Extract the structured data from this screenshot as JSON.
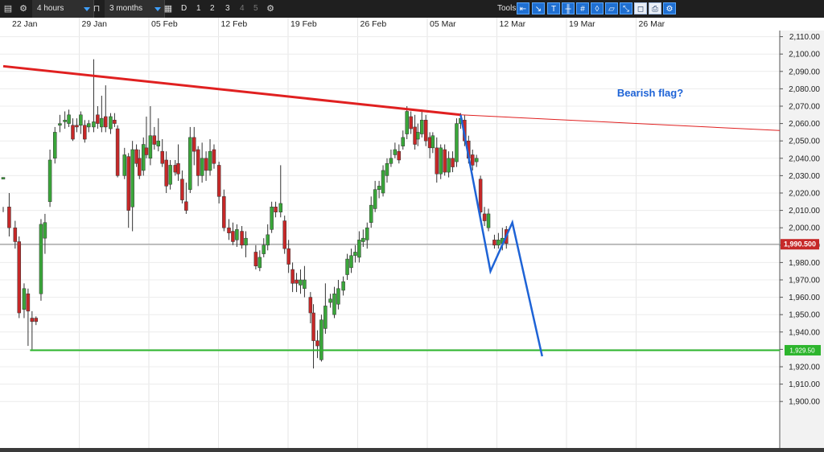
{
  "toolbar": {
    "timeframe": "4 hours",
    "range": "3 months",
    "periods": [
      "D",
      "1",
      "2",
      "3",
      "4",
      "5"
    ],
    "tools_label": "Tools",
    "tool_icons": [
      "arrow-left-icon",
      "cursor-icon",
      "text-tool-icon",
      "crosshair-icon",
      "grid-icon",
      "marker-icon",
      "layers-icon",
      "zoom-icon",
      "eraser-icon",
      "print-icon",
      "settings-icon"
    ]
  },
  "chart_data": {
    "type": "candlestick",
    "instrument_price": 1990.5,
    "x_tick_labels": [
      "22 Jan",
      "29 Jan",
      "05 Feb",
      "12 Feb",
      "19 Feb",
      "26 Feb",
      "05 Mar",
      "12 Mar",
      "19 Mar",
      "26 Mar"
    ],
    "y_range": [
      1890,
      2115
    ],
    "y_ticks": [
      2110,
      2100,
      2090,
      2080,
      2070,
      2060,
      2050,
      2040,
      2030,
      2020,
      2010,
      2000,
      1990,
      1980,
      1970,
      1960,
      1950,
      1940,
      1930,
      1920,
      1910,
      1900
    ],
    "y_tick_labels": [
      "2,110.00",
      "2,100.00",
      "2,090.00",
      "2,080.00",
      "2,070.00",
      "2,060.00",
      "2,050.00",
      "2,040.00",
      "2,030.00",
      "2,020.00",
      "2,010.00",
      "2,000.00",
      "1,990.00",
      "1,980.00",
      "1,970.00",
      "1,960.00",
      "1,950.00",
      "1,940.00",
      "1,930.00",
      "1,920.00",
      "1,910.00",
      "1,900.00"
    ],
    "current_price_label": "1,990.500",
    "support_label": "1,929.50",
    "support_level": 1929.5,
    "annotation": "Bearish flag?",
    "colors": {
      "up": "#3aa63a",
      "down": "#c62828",
      "resistance": "#e02020",
      "support": "#2db52d",
      "projection": "#1e63d6",
      "annotation": "#1e63d6"
    },
    "resistance_line": [
      [
        0,
        2093
      ],
      [
        46,
        2065
      ],
      [
        64,
        2056
      ]
    ],
    "projection_path": [
      [
        46,
        2065
      ],
      [
        49,
        1975
      ],
      [
        51.2,
        2003
      ],
      [
        54.2,
        1926
      ]
    ],
    "candles": [
      [
        0,
        2028,
        2029,
        2012,
        2009
      ],
      [
        0.6,
        2012,
        2000,
        1995,
        2020
      ],
      [
        1.2,
        2000,
        1992,
        1988,
        2004
      ],
      [
        1.6,
        1992,
        1951,
        1948,
        1995
      ],
      [
        2.1,
        1953,
        1965,
        1948,
        1968
      ],
      [
        2.5,
        1962,
        1952,
        1932,
        1965
      ],
      [
        2.9,
        1948,
        1946,
        1930,
        1952
      ],
      [
        3.3,
        1948,
        1946,
        1944,
        1949
      ],
      [
        3.8,
        1962,
        2002,
        1958,
        2005
      ],
      [
        4.2,
        1994,
        2003,
        1985,
        2008
      ],
      [
        4.7,
        2015,
        2039,
        2012,
        2045
      ],
      [
        5.2,
        2040,
        2055,
        2037,
        2058
      ],
      [
        5.7,
        2059,
        2060,
        2055,
        2065
      ],
      [
        6.2,
        2061,
        2062,
        2057,
        2067
      ],
      [
        6.6,
        2060,
        2065,
        2058,
        2068
      ],
      [
        7.0,
        2059,
        2051,
        2050,
        2063
      ],
      [
        7.4,
        2059,
        2058,
        2055,
        2063
      ],
      [
        7.8,
        2059,
        2065,
        2054,
        2067
      ],
      [
        8.2,
        2059,
        2051,
        2049,
        2062
      ],
      [
        8.6,
        2058,
        2060,
        2055,
        2062
      ],
      [
        9.1,
        2058,
        2061,
        2055,
        2097
      ],
      [
        9.5,
        2065,
        2060,
        2057,
        2070
      ],
      [
        9.9,
        2058,
        2063,
        2055,
        2076
      ],
      [
        10.3,
        2064,
        2058,
        2055,
        2082
      ],
      [
        10.8,
        2057,
        2064,
        2054,
        2066
      ],
      [
        11.2,
        2062,
        2060,
        2058,
        2066
      ],
      [
        11.5,
        2057,
        2030,
        2029,
        2059
      ],
      [
        12.2,
        2030,
        2042,
        2028,
        2046
      ],
      [
        12.6,
        2041,
        2010,
        2000,
        2043
      ],
      [
        13.0,
        2012,
        2045,
        1998,
        2050
      ],
      [
        13.4,
        2045,
        2037,
        2035,
        2048
      ],
      [
        13.7,
        2040,
        2030,
        2028,
        2045
      ],
      [
        14.1,
        2033,
        2048,
        2030,
        2052
      ],
      [
        14.4,
        2046,
        2042,
        2040,
        2064
      ],
      [
        14.8,
        2040,
        2053,
        2036,
        2070
      ],
      [
        15.2,
        2053,
        2048,
        2045,
        2058
      ],
      [
        15.6,
        2047,
        2050,
        2044,
        2063
      ],
      [
        16.0,
        2044,
        2037,
        2035,
        2051
      ],
      [
        16.4,
        2039,
        2024,
        2020,
        2044
      ],
      [
        16.8,
        2025,
        2036,
        2022,
        2039
      ],
      [
        17.3,
        2036,
        2032,
        2030,
        2039
      ],
      [
        17.6,
        2037,
        2031,
        2027,
        2048
      ],
      [
        18.0,
        2028,
        2016,
        2014,
        2033
      ],
      [
        18.4,
        2015,
        2010,
        2008,
        2026
      ],
      [
        18.8,
        2022,
        2052,
        2020,
        2058
      ],
      [
        19.2,
        2052,
        2044,
        2036,
        2058
      ],
      [
        19.6,
        2045,
        2030,
        2024,
        2047
      ],
      [
        20.0,
        2030,
        2040,
        2026,
        2049
      ],
      [
        20.4,
        2040,
        2033,
        2027,
        2044
      ],
      [
        20.8,
        2033,
        2044,
        2030,
        2051
      ],
      [
        21.2,
        2045,
        2037,
        2034,
        2048
      ],
      [
        21.7,
        2036,
        2018,
        2014,
        2038
      ],
      [
        22.2,
        2018,
        2000,
        1998,
        2022
      ],
      [
        22.7,
        2000,
        1997,
        1993,
        2005
      ],
      [
        23.1,
        1998,
        1992,
        1990,
        2003
      ],
      [
        23.5,
        1993,
        1999,
        1989,
        2002
      ],
      [
        24.0,
        1998,
        1990,
        1988,
        2001
      ],
      [
        24.4,
        1990,
        1994,
        1983,
        1998
      ],
      [
        25.4,
        1986,
        1978,
        1976,
        1990
      ],
      [
        25.8,
        1977,
        1983,
        1975,
        1987
      ],
      [
        26.2,
        1985,
        1990,
        1983,
        1994
      ],
      [
        26.6,
        1990,
        1996,
        1987,
        2002
      ],
      [
        27.0,
        1999,
        2012,
        1997,
        2015
      ],
      [
        27.4,
        2012,
        2009,
        2006,
        2015
      ],
      [
        27.9,
        2009,
        2014,
        2006,
        2036
      ],
      [
        28.3,
        2004,
        1988,
        1985,
        2007
      ],
      [
        28.7,
        1988,
        1979,
        1974,
        1993
      ],
      [
        29.1,
        1976,
        1968,
        1963,
        1980
      ],
      [
        29.5,
        1970,
        1968,
        1963,
        1974
      ],
      [
        29.9,
        1967,
        1970,
        1962,
        1976
      ],
      [
        30.3,
        1965,
        1970,
        1960,
        1978
      ],
      [
        30.9,
        1960,
        1951,
        1945,
        1963
      ],
      [
        31.2,
        1951,
        1935,
        1919,
        1956
      ],
      [
        31.6,
        1935,
        1932,
        1925,
        1941
      ],
      [
        32.0,
        1924,
        1947,
        1923,
        1950
      ],
      [
        32.4,
        1942,
        1955,
        1939,
        1968
      ],
      [
        32.9,
        1957,
        1959,
        1954,
        1962
      ],
      [
        33.3,
        1950,
        1962,
        1948,
        1966
      ],
      [
        33.7,
        1956,
        1965,
        1953,
        1970
      ],
      [
        34.2,
        1964,
        1969,
        1961,
        1972
      ],
      [
        34.6,
        1973,
        1982,
        1970,
        1985
      ],
      [
        35.0,
        1977,
        1984,
        1974,
        1988
      ],
      [
        35.4,
        1984,
        1986,
        1980,
        1990
      ],
      [
        35.8,
        1983,
        1993,
        1980,
        1998
      ],
      [
        36.2,
        1992,
        1994,
        1989,
        1999
      ],
      [
        36.6,
        1993,
        2000,
        1988,
        2003
      ],
      [
        37.0,
        2003,
        2013,
        2000,
        2018
      ],
      [
        37.4,
        2011,
        2022,
        2009,
        2027
      ],
      [
        37.8,
        2022,
        2024,
        2017,
        2027
      ],
      [
        38.2,
        2020,
        2033,
        2018,
        2036
      ],
      [
        38.6,
        2030,
        2037,
        2026,
        2040
      ],
      [
        39.0,
        2037,
        2040,
        2035,
        2045
      ],
      [
        39.4,
        2042,
        2045,
        2040,
        2049
      ],
      [
        39.8,
        2044,
        2039,
        2037,
        2048
      ],
      [
        40.2,
        2047,
        2052,
        2045,
        2056
      ],
      [
        40.6,
        2054,
        2067,
        2051,
        2070
      ],
      [
        41.0,
        2064,
        2057,
        2054,
        2067
      ],
      [
        41.4,
        2058,
        2048,
        2045,
        2065
      ],
      [
        41.7,
        2051,
        2055,
        2047,
        2060
      ],
      [
        42.1,
        2054,
        2062,
        2052,
        2068
      ],
      [
        42.5,
        2062,
        2050,
        2047,
        2065
      ],
      [
        42.9,
        2052,
        2046,
        2040,
        2055
      ],
      [
        43.2,
        2046,
        2053,
        2043,
        2055
      ],
      [
        43.6,
        2046,
        2031,
        2026,
        2052
      ],
      [
        44.0,
        2031,
        2046,
        2028,
        2048
      ],
      [
        44.4,
        2045,
        2032,
        2030,
        2048
      ],
      [
        44.8,
        2032,
        2040,
        2029,
        2044
      ],
      [
        45.2,
        2040,
        2035,
        2032,
        2044
      ],
      [
        45.6,
        2038,
        2060,
        2035,
        2063
      ],
      [
        46.0,
        2060,
        2063,
        2057,
        2066
      ],
      [
        46.4,
        2062,
        2050,
        2047,
        2065
      ],
      [
        46.8,
        2050,
        2040,
        2037,
        2053
      ],
      [
        47.2,
        2042,
        2036,
        2033,
        2045
      ],
      [
        47.6,
        2038,
        2040,
        2035,
        2042
      ],
      [
        48.0,
        2028,
        2009,
        2006,
        2030
      ],
      [
        48.4,
        2008,
        2004,
        2001,
        2012
      ],
      [
        48.8,
        2000,
        2008,
        1998,
        2011
      ],
      [
        49.4,
        1993,
        1990,
        1988,
        1996
      ],
      [
        49.8,
        1990,
        1993,
        1988,
        1997
      ],
      [
        50.2,
        1991,
        1994,
        1987,
        2000
      ],
      [
        50.6,
        1999,
        1991,
        1988,
        2001
      ]
    ]
  }
}
